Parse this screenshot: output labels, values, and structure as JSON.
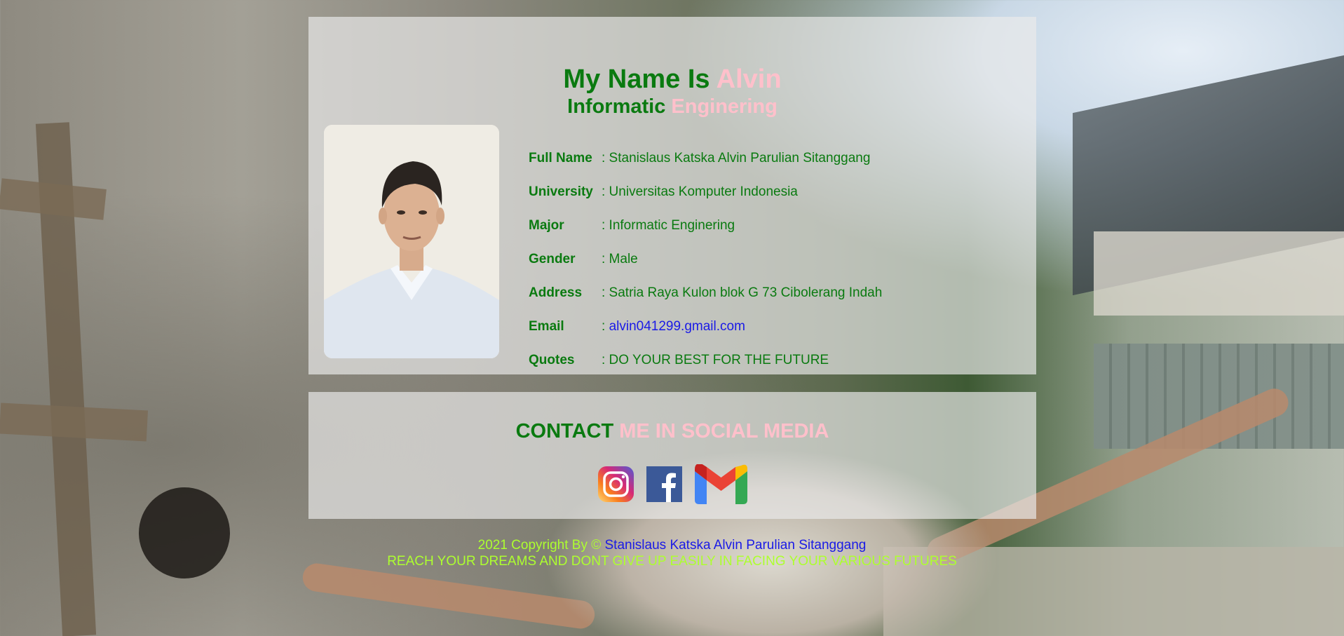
{
  "header": {
    "title_prefix": "My Name Is",
    "title_name": "Alvin",
    "subtitle_first": "Informatic",
    "subtitle_second": "Enginering"
  },
  "profile": {
    "rows": [
      {
        "label": "Full Name",
        "value": ": Stanislaus Katska Alvin Parulian Sitanggang"
      },
      {
        "label": "University",
        "value": ": Universitas Komputer Indonesia"
      },
      {
        "label": "Major",
        "value": ": Informatic Enginering"
      },
      {
        "label": "Gender",
        "value": ": Male"
      },
      {
        "label": "Address",
        "value": ": Satria Raya Kulon blok G 73 Cibolerang Indah"
      },
      {
        "label": "Email",
        "value_prefix": ": ",
        "value": "alvin041299.gmail.com"
      },
      {
        "label": "Quotes",
        "value": ": DO YOUR BEST FOR THE FUTURE"
      }
    ]
  },
  "contact": {
    "title_first": "CONTACT",
    "title_second": "ME IN SOCIAL MEDIA",
    "icons": [
      "instagram-icon",
      "facebook-icon",
      "gmail-icon"
    ]
  },
  "footer": {
    "copyright_prefix": "2021 Copyright By ©",
    "copyright_name": "Stanislaus Katska Alvin Parulian Sitanggang",
    "tagline": "REACH YOUR DREAMS AND DONT GIVE UP EASILY IN FACING YOUR VARIOUS FUTURES"
  },
  "colors": {
    "green": "#0a7a10",
    "pink": "#ffc0cb",
    "link": "#1a1ae6",
    "footer": "#adff2f"
  }
}
